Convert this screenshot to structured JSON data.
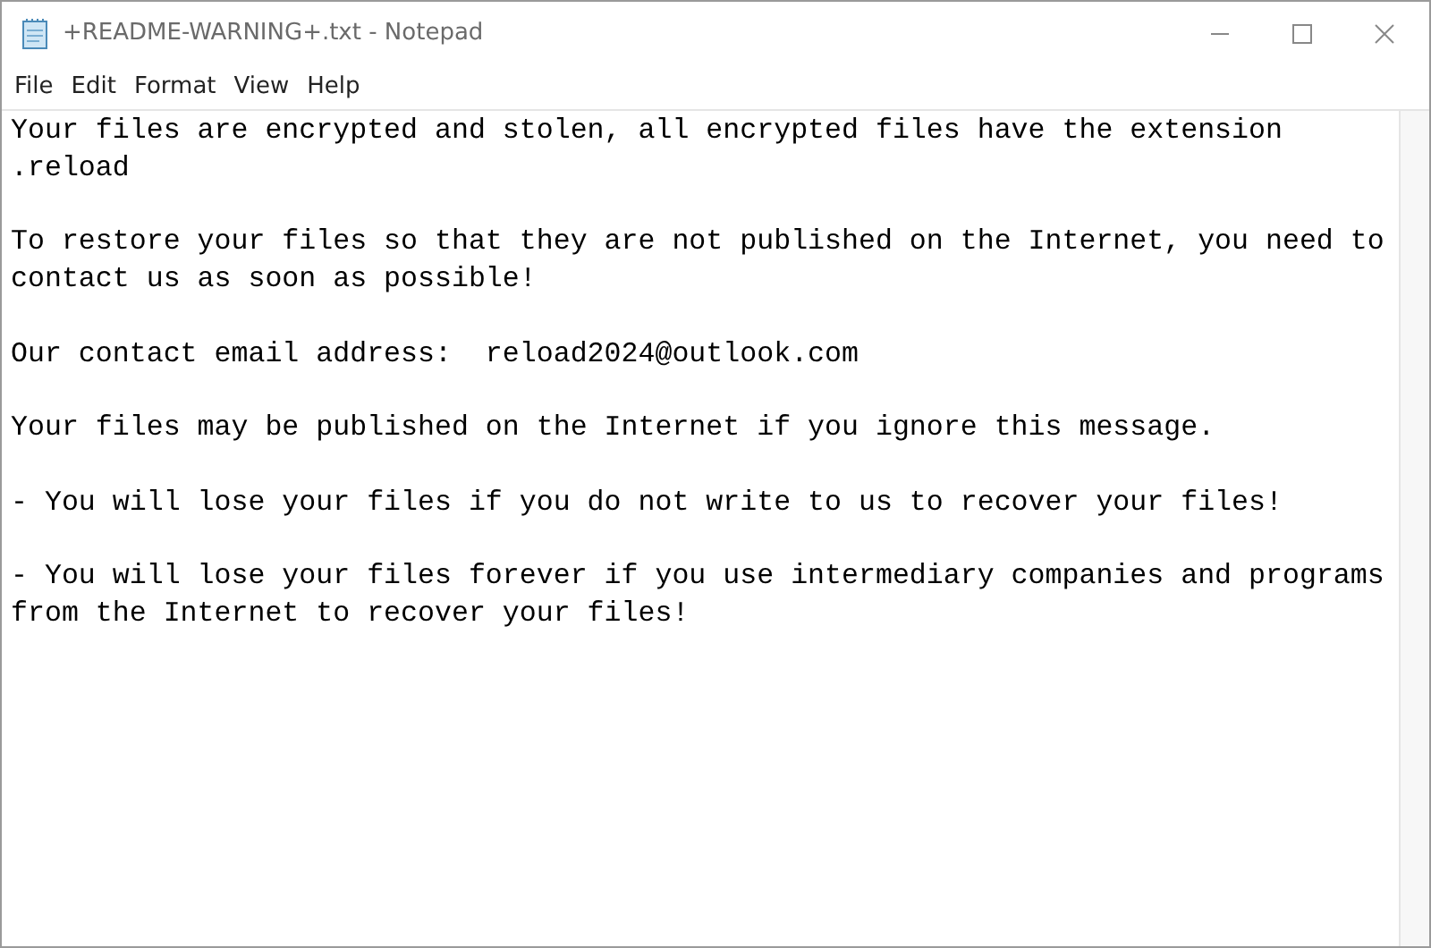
{
  "window": {
    "title": "+README-WARNING+.txt - Notepad"
  },
  "menu": [
    "File",
    "Edit",
    "Format",
    "View",
    "Help"
  ],
  "document": {
    "paragraphs": [
      {
        "lines": [
          "Your files are encrypted and stolen, all encrypted files have the extension",
          ".reload"
        ]
      },
      {
        "lines": [
          "To restore your files so that they are not published on the Internet, you need to",
          "contact us as soon as possible!"
        ]
      },
      {
        "lines": [
          "Our contact email address:  reload2024@outlook.com"
        ]
      },
      {
        "lines": [
          "Your files may be published on the Internet if you ignore this message."
        ]
      },
      {
        "lines": [
          "- You will lose your files if you do not write to us to recover your files!"
        ]
      },
      {
        "lines": [
          "- You will lose your files forever if you use intermediary companies and programs",
          "from the Internet to recover your files!"
        ]
      }
    ]
  }
}
